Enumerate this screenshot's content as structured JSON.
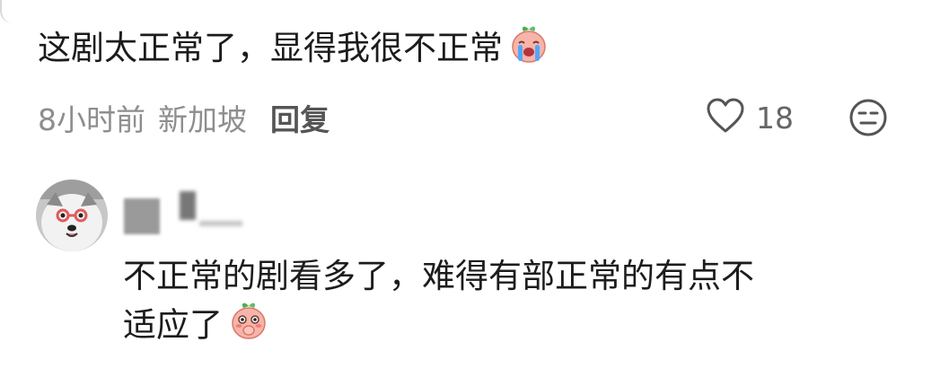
{
  "comment": {
    "text": "这剧太正常了，显得我很不正常",
    "emoji": "crying-peach-emoji",
    "time": "8小时前",
    "location": "新加坡",
    "reply_label": "回复",
    "like_count": "18",
    "icons": {
      "like": "heart-outline-icon",
      "more": "neutral-face-icon"
    }
  },
  "reply": {
    "avatar": "dog-avatar",
    "text_line1": "不正常的剧看多了，难得有部正常的有点不",
    "text_line2": "适应了",
    "emoji": "shy-peach-emoji"
  },
  "colors": {
    "text": "#1c1c1c",
    "meta": "#8e8e8e",
    "reply_button": "#555555"
  }
}
